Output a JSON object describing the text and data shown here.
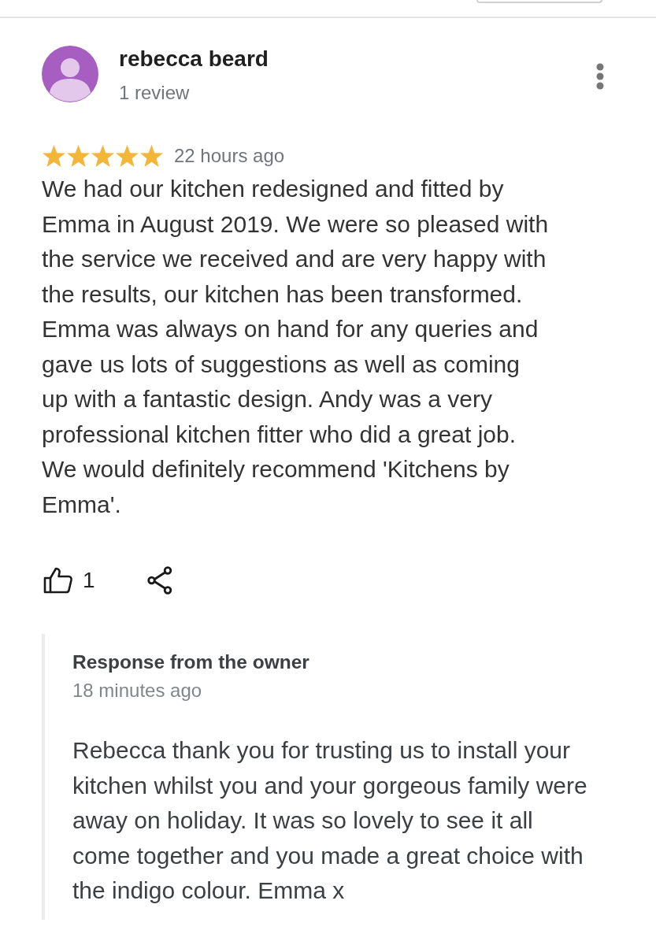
{
  "review": {
    "author": {
      "name": "rebecca beard",
      "review_count": "1 review"
    },
    "stars": 5,
    "time": "22 hours ago",
    "text": "We had our kitchen redesigned and fitted by Emma in August 2019. We were so pleased with the service we received and are very happy with the results, our kitchen has been transformed. Emma was always on hand for any queries and gave us lots of suggestions as well as coming up with a fantastic design. Andy was a very professional kitchen fitter who did a great job. We would definitely recommend 'Kitchens by Emma'.",
    "likes": "1"
  },
  "owner_response": {
    "title": "Response from the owner",
    "time": "18 minutes ago",
    "text": "Rebecca thank you for trusting us to install your kitchen whilst you and your gorgeous family were away on holiday. It was so lovely to see it all come together and you made a great choice with the indigo colour. Emma x"
  }
}
